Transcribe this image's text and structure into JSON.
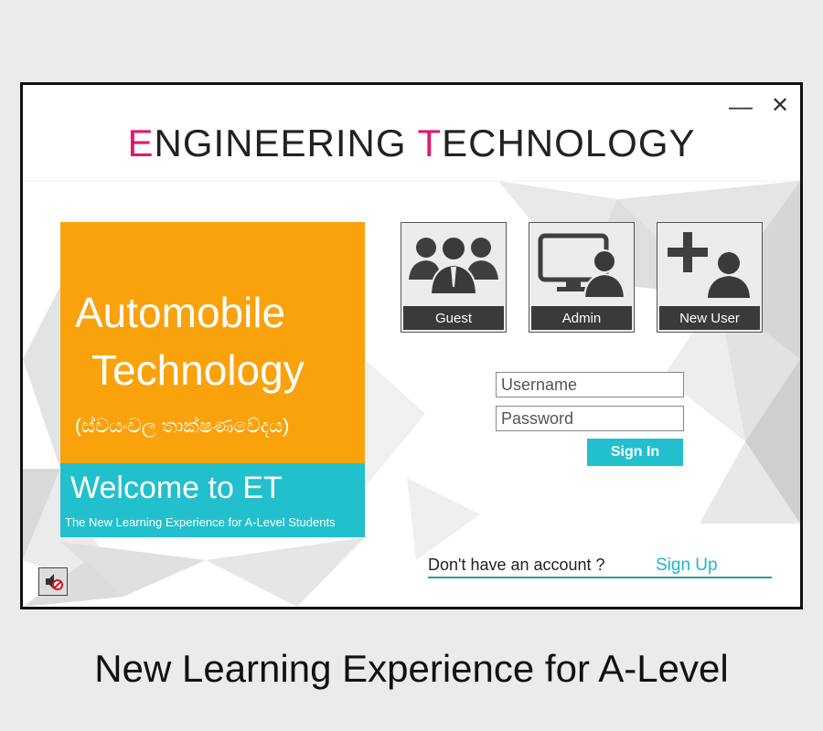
{
  "window": {
    "title_part1_accent": "E",
    "title_part1_rest": "NGINEERING ",
    "title_part2_accent": "T",
    "title_part2_rest": "ECHNOLOGY",
    "minimize_icon": "minimize-icon",
    "close_icon": "close-icon"
  },
  "panel": {
    "line1": "Automobile",
    "line2": "Technology",
    "sinhala": "(ස්වයංචල තාක්ෂණවේදය)",
    "welcome": "Welcome to ET",
    "tagline": "The New Learning Experience for A-Level Students"
  },
  "tiles": [
    {
      "label": "Guest",
      "icon": "users-group-icon"
    },
    {
      "label": "Admin",
      "icon": "monitor-user-icon"
    },
    {
      "label": "New User",
      "icon": "add-user-icon"
    }
  ],
  "login": {
    "username_placeholder": "Username",
    "password_placeholder": "Password",
    "signin_label": "Sign In",
    "no_account_text": "Don't have an account ?",
    "signup_label": "Sign Up"
  },
  "sound": {
    "icon": "mute-icon"
  },
  "caption": "New Learning Experience for A-Level",
  "colors": {
    "accent_pink": "#e0196e",
    "orange": "#f9a20c",
    "teal": "#21c0cc",
    "tile_label_bg": "#3a3a3a"
  }
}
